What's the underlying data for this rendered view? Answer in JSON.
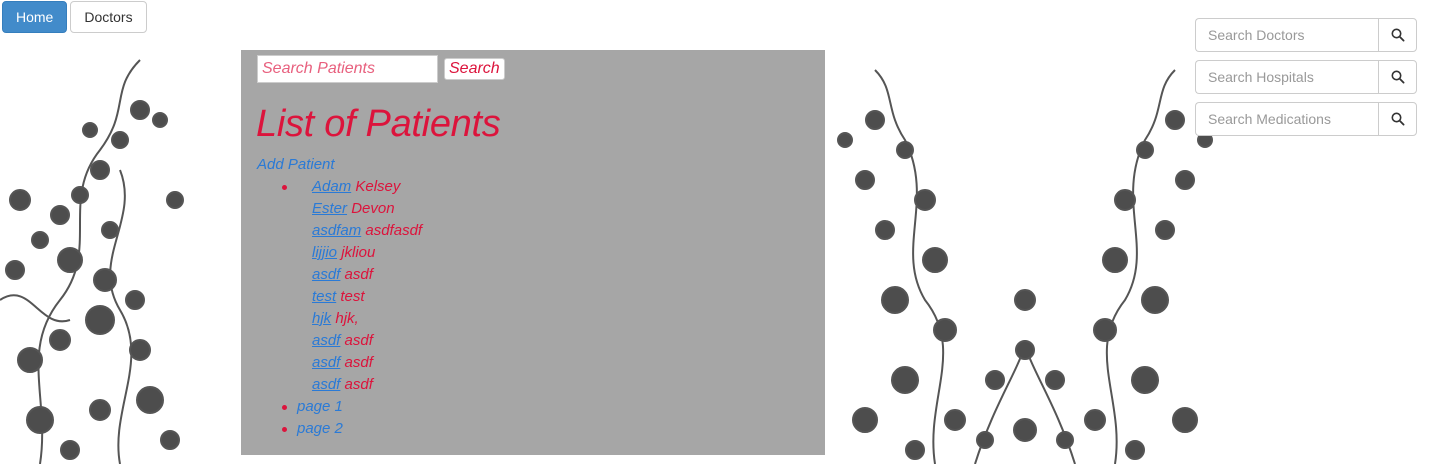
{
  "nav": {
    "home_label": "Home",
    "doctors_label": "Doctors"
  },
  "sidebar_search": [
    {
      "placeholder": "Search Doctors",
      "icon": "search-icon"
    },
    {
      "placeholder": "Search Hospitals",
      "icon": "search-icon"
    },
    {
      "placeholder": "Search Medications",
      "icon": "search-icon"
    }
  ],
  "patient_search": {
    "placeholder": "Search Patients",
    "button_label": "Search"
  },
  "title": "List of Patients",
  "add_patient_label": "Add Patient",
  "patients": [
    {
      "first": "Adam",
      "last": "Kelsey"
    },
    {
      "first": "Ester",
      "last": "Devon"
    },
    {
      "first": "asdfam",
      "last": "asdfasdf"
    },
    {
      "first": "lijjio",
      "last": "jkliou"
    },
    {
      "first": "asdf",
      "last": "asdf"
    },
    {
      "first": "test",
      "last": "test"
    },
    {
      "first": "hjk",
      "last": "hjk,"
    },
    {
      "first": "asdf",
      "last": "asdf"
    },
    {
      "first": "asdf",
      "last": "asdf"
    },
    {
      "first": "asdf",
      "last": "asdf"
    }
  ],
  "pages": [
    "page 1",
    "page 2"
  ],
  "colors": {
    "primary_button": "#428bca",
    "panel_background": "#a6a6a6",
    "accent_red": "#dc143c",
    "link_blue": "#2a7ad6"
  }
}
